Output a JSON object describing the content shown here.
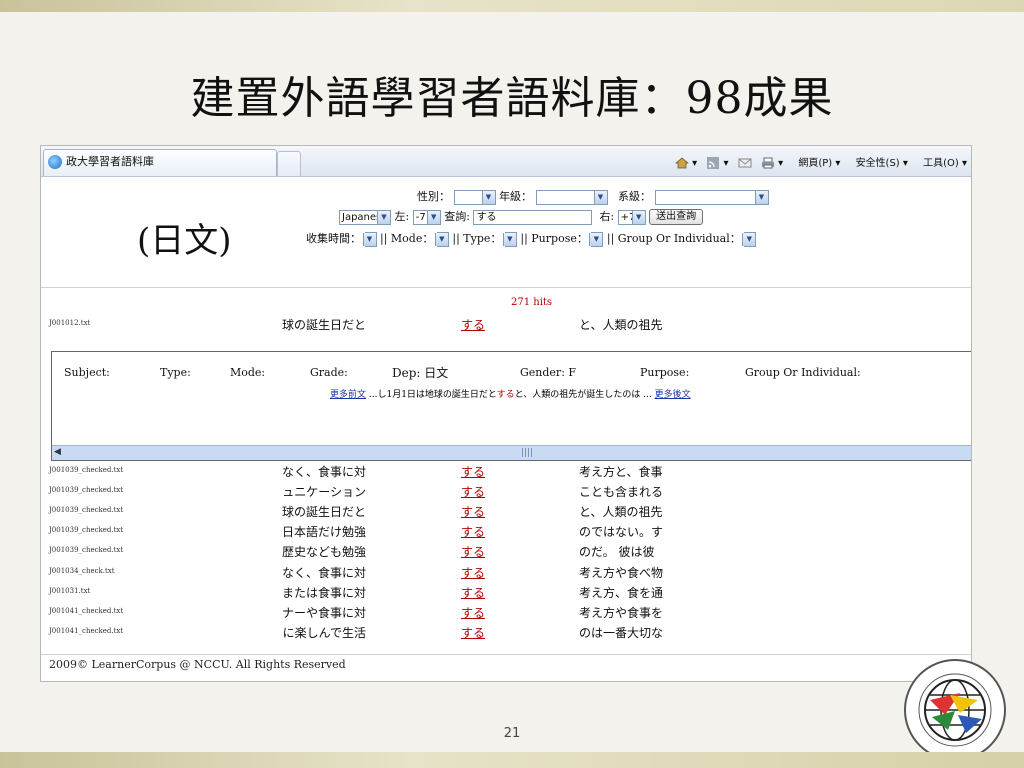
{
  "slide": {
    "title": "建置外語學習者語料庫：98成果",
    "language_label": "(日文)",
    "page_number": "21"
  },
  "browser": {
    "tab_title": "政大學習者語料庫",
    "toolbar": {
      "home_icon": "home-icon",
      "feed_icon": "rss-icon",
      "mail_icon": "mail-icon",
      "print_icon": "print-icon",
      "page_menu": "網頁(P)",
      "safety_menu": "安全性(S)",
      "tools_menu": "工具(O)"
    }
  },
  "search_form": {
    "gender_label": "性別：",
    "grade_label": "年級：",
    "dept_label": "系級：",
    "language_value": "Japanese",
    "left_label": "左:",
    "left_value": "-7",
    "query_label": "查詢:",
    "query_value": "する",
    "right_label": "右:",
    "right_value": "+7",
    "submit_label": "送出查詢",
    "collect_time_label": "收集時間：",
    "mode_label": "|| Mode：",
    "type_label": "|| Type：",
    "purpose_label": "|| Purpose：",
    "group_label": "|| Group Or Individual："
  },
  "results": {
    "hits": "271 hits",
    "first_row": {
      "file": "J001012.txt",
      "left": "球の誕生日だと",
      "keyword": "する",
      "right": "と、人類の祖先"
    },
    "detail": {
      "subject": "Subject:",
      "type": "Type:",
      "mode": "Mode:",
      "grade": "Grade:",
      "dep": "Dep: 日文",
      "gender": "Gender: F",
      "purpose": "Purpose:",
      "group": "Group Or Individual:",
      "more_before": "更多前文",
      "sentence_left": "...し1月1日は地球の誕生日だと",
      "sentence_kw": "する",
      "sentence_right": "と、人類の祖先が誕生したのは ...",
      "more_after": "更多後文"
    },
    "rows": [
      {
        "file": "J001039_checked.txt",
        "left": "なく、食事に対",
        "keyword": "する",
        "right": "考え方と、食事"
      },
      {
        "file": "J001039_checked.txt",
        "left": "ュニケーション",
        "keyword": "する",
        "right": "ことも含まれる"
      },
      {
        "file": "J001039_checked.txt",
        "left": "球の誕生日だと",
        "keyword": "する",
        "right": "と、人類の祖先"
      },
      {
        "file": "J001039_checked.txt",
        "left": "日本語だけ勉強",
        "keyword": "する",
        "right": "のではない。す"
      },
      {
        "file": "J001039_checked.txt",
        "left": "歴史なども勉強",
        "keyword": "する",
        "right": "のだ。 彼は彼"
      },
      {
        "file": "J001034_check.txt",
        "left": "なく、食事に対",
        "keyword": "する",
        "right": "考え方や食べ物"
      },
      {
        "file": "J001031.txt",
        "left": "または食事に対",
        "keyword": "する",
        "right": "考え方、食を通"
      },
      {
        "file": "J001041_checked.txt",
        "left": "ナーや食事に対",
        "keyword": "する",
        "right": "考え方や食事を"
      },
      {
        "file": "J001041_checked.txt",
        "left": "に楽しんで生活",
        "keyword": "する",
        "right": "のは一番大切な"
      }
    ]
  },
  "footer": "2009© LearnerCorpus @ NCCU. All Rights Reserved",
  "colors": {
    "keyword": "#b00000",
    "link": "#1b36a8",
    "scrollbar": "#c9daf3"
  }
}
